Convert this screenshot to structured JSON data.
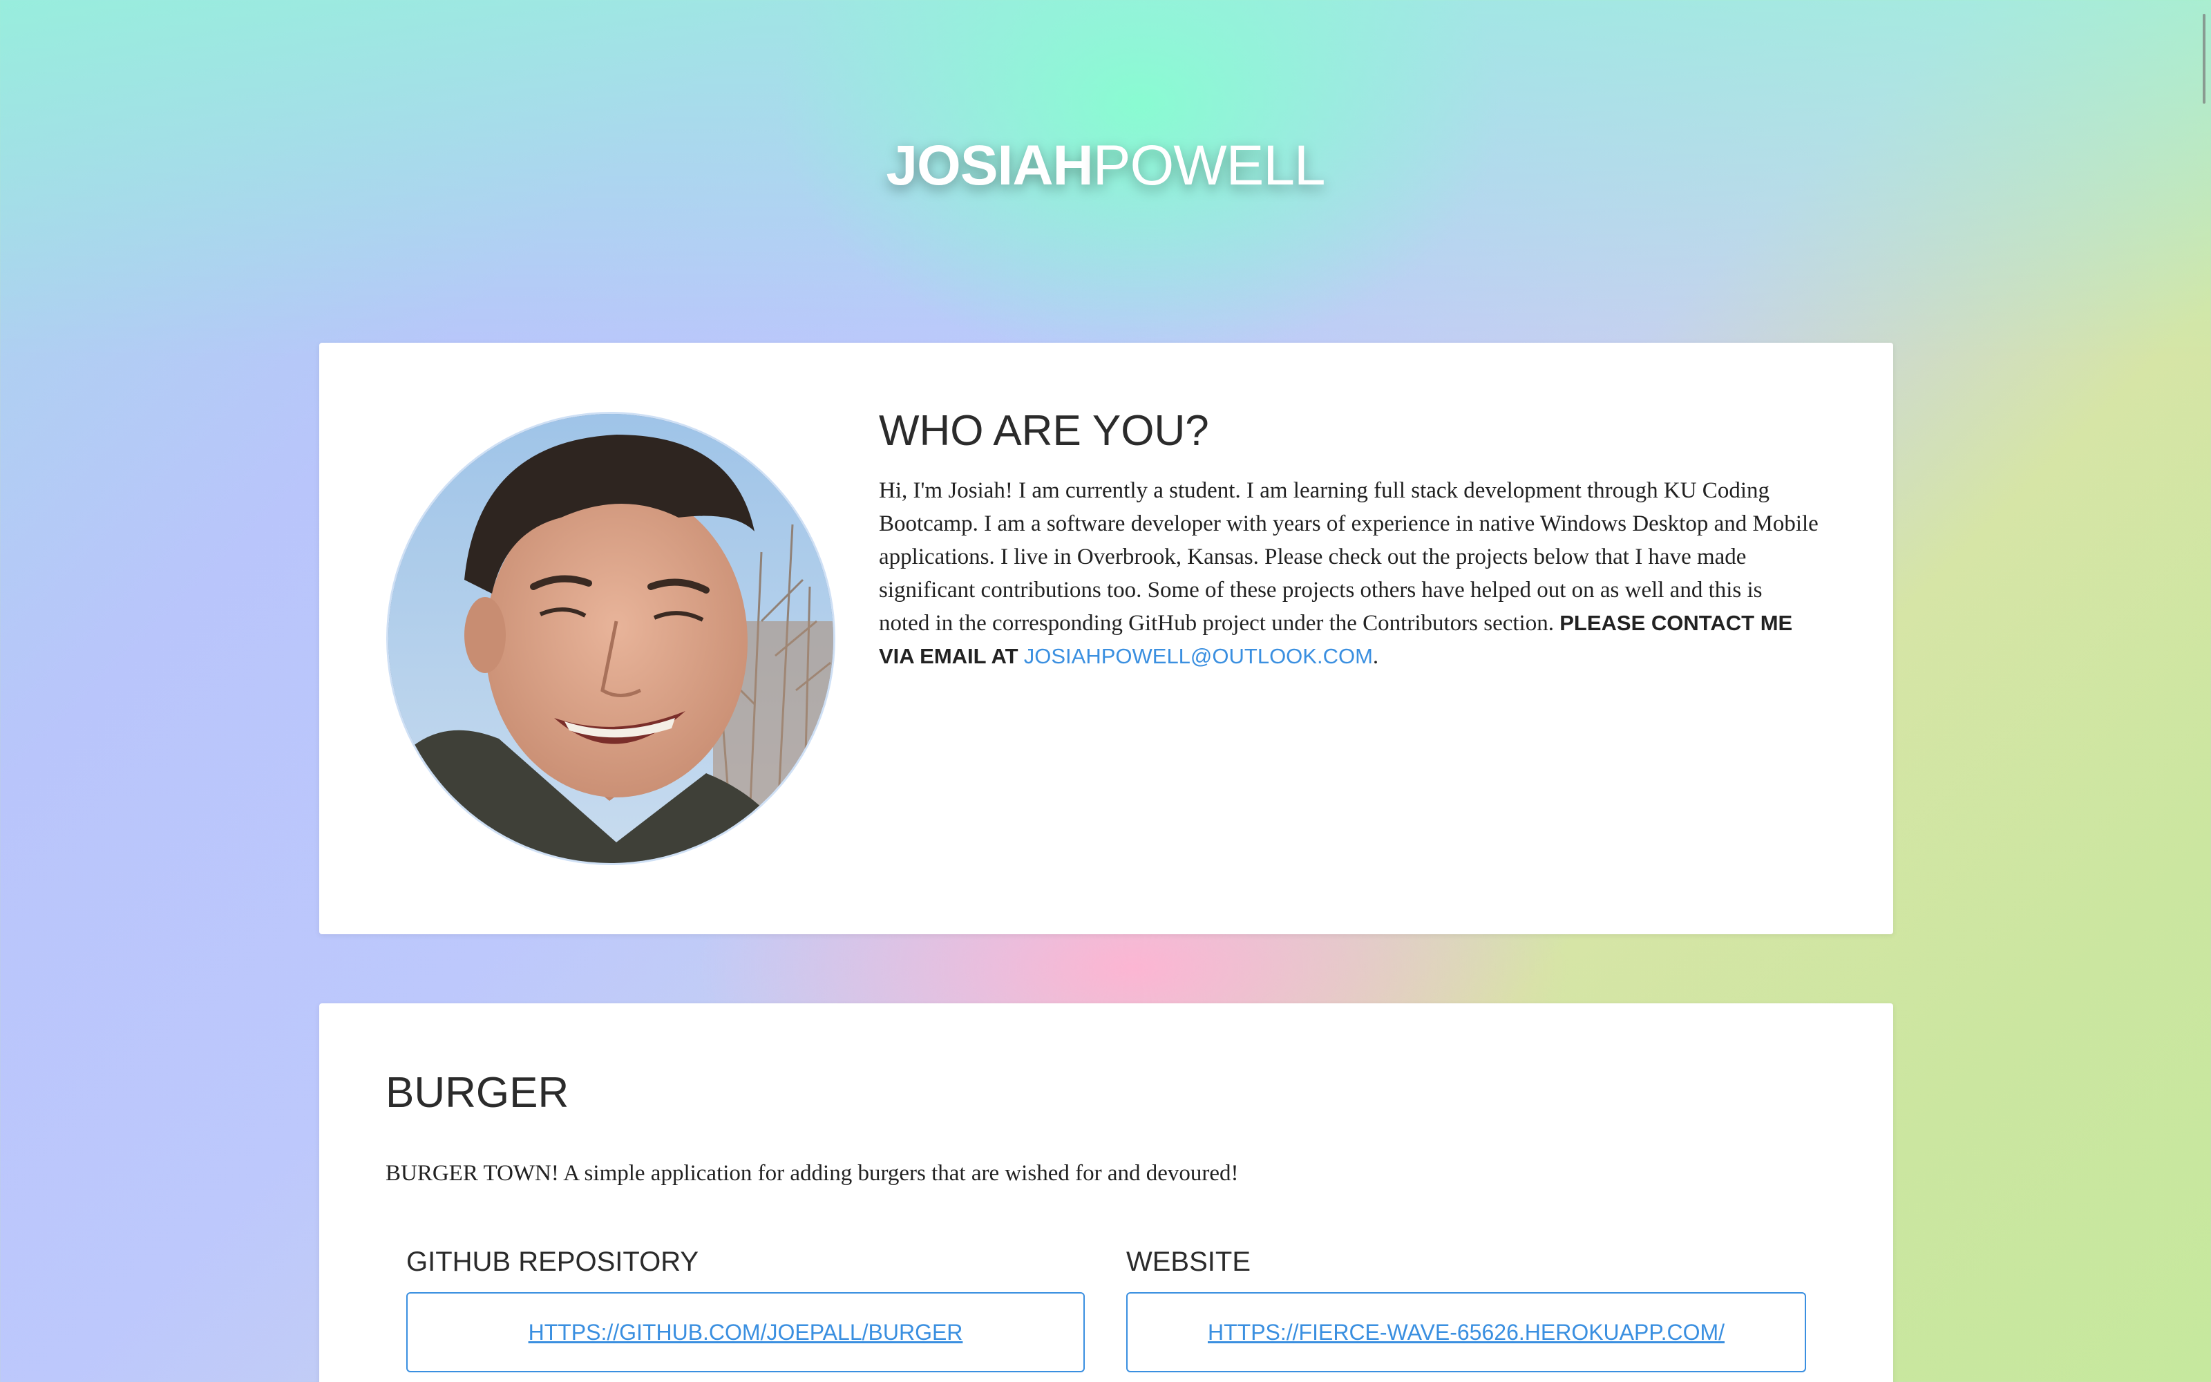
{
  "header": {
    "first_name": "JOSIAH",
    "last_name": "POWELL"
  },
  "about": {
    "title": "WHO ARE YOU?",
    "paragraph": "Hi, I'm Josiah! I am currently a student. I am learning full stack development through KU Coding Bootcamp. I am a software developer with years of experience in native Windows Desktop and Mobile applications. I live in Overbrook, Kansas. Please check out the projects below that I have made significant contributions too. Some of these projects others have helped out on as well and this is noted in the corresponding GitHub project under the Contributors section.",
    "contact_prefix": "PLEASE CONTACT ME VIA EMAIL AT",
    "email": "JOSIAHPOWELL@OUTLOOK.COM",
    "contact_suffix": "."
  },
  "project": {
    "title": "BURGER",
    "description": "BURGER TOWN! A simple application for adding burgers that are wished for and devoured!",
    "github_label": "GITHUB REPOSITORY",
    "github_url": "HTTPS://GITHUB.COM/JOEPALL/BURGER",
    "website_label": "WEBSITE",
    "website_url": "HTTPS://FIERCE-WAVE-65626.HEROKUAPP.COM/"
  },
  "colors": {
    "accent": "#3a8fe0",
    "card": "#ffffff"
  }
}
